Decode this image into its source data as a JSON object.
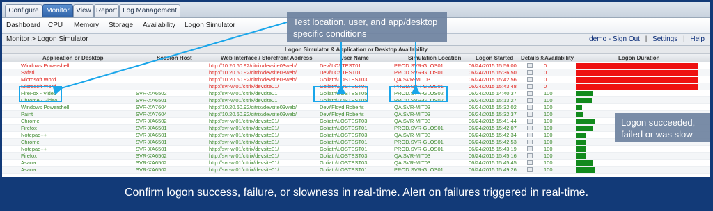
{
  "tabs": [
    {
      "label": "Configure",
      "active": false
    },
    {
      "label": "Monitor",
      "active": true
    },
    {
      "label": "View",
      "active": false
    },
    {
      "label": "Report",
      "active": false
    },
    {
      "label": "Log Management",
      "active": false
    }
  ],
  "subnav": [
    "Dashboard",
    "CPU",
    "Memory",
    "Storage",
    "Availability",
    "Logon Simulator"
  ],
  "breadcrumb": "Monitor > Logon Simulator",
  "user_links": {
    "signout": "demo - Sign Out",
    "settings": "Settings",
    "help": "Help",
    "separator": "|"
  },
  "panel_title": "Logon Simulator & Application or Desktop Availability",
  "columns": {
    "app": "Application or Desktop",
    "session": "Session Host",
    "web": "Web Interface / Storefront Address",
    "user": "User Name",
    "sim": "Simulation Location",
    "started": "Logon Started",
    "details": "Details",
    "avail": "%Availability",
    "duration": "Logon Duration"
  },
  "rows": [
    {
      "app": "Windows Powershell",
      "session": "",
      "web": "http://10.20.60.92/citrix/devsite03web/",
      "user": "Devi\\LOSTEST01",
      "sim": "PROD.SVR-GLOS01",
      "started": "06/24/2015 15:56:00",
      "availability": "0",
      "status": "fail",
      "duration_fraction": 1.0
    },
    {
      "app": "Safari",
      "session": "",
      "web": "http://10.20.60.92/citrix/devsite03web/",
      "user": "Devi\\LOSTEST01",
      "sim": "PROD.SVR-GLOS01",
      "started": "06/24/2015 15:36:50",
      "availability": "0",
      "status": "fail",
      "duration_fraction": 1.0
    },
    {
      "app": "Microsoft Word",
      "session": "",
      "web": "http://10.20.60.92/citrix/devsite03web/",
      "user": "Goliath\\LOSTEST03",
      "sim": "QA.SVR-MIT03",
      "started": "06/24/2015 15:42:56",
      "availability": "0",
      "status": "fail",
      "duration_fraction": 1.0
    },
    {
      "app": "Microsoft Word",
      "session": "",
      "web": "http://svr-wi01/citrix/devsite01/",
      "user": "Goliath\\LOSTEST01",
      "sim": "PROD.SVR-GLOS01",
      "started": "06/24/2015 15:43:48",
      "availability": "0",
      "status": "fail",
      "duration_fraction": 1.0
    },
    {
      "app": "FireFox - Video",
      "session": "SVR-XA6502",
      "web": "http://svr-wi01/citrix/devsite01",
      "user": "Goliath\\LOSTEST05",
      "sim": "PROD.SVR-GLOS02",
      "started": "06/24/2015 14:40:37",
      "availability": "100",
      "status": "ok",
      "duration_fraction": 0.14
    },
    {
      "app": "Chrome - Video",
      "session": "SVR-XA6501",
      "web": "http://svr-wi01/citrix/devsite01",
      "user": "Goliath\\LOSTEST05",
      "sim": "PROD.SVR-GLOS02",
      "started": "06/24/2015 15:13:27",
      "availability": "100",
      "status": "ok",
      "duration_fraction": 0.13
    },
    {
      "app": "Windows Powershell",
      "session": "SVR-XA7604",
      "web": "http://10.20.60.92/citrix/devsite03web/",
      "user": "Devi\\Floyd Roberts",
      "sim": "QA.SVR-MIT03",
      "started": "06/24/2015 15:32:02",
      "availability": "100",
      "status": "ok",
      "duration_fraction": 0.05
    },
    {
      "app": "Paint",
      "session": "SVR-XA7604",
      "web": "http://10.20.60.92/citrix/devsite03web/",
      "user": "Devi\\Floyd Roberts",
      "sim": "QA.SVR-MIT03",
      "started": "06/24/2015 15:32:37",
      "availability": "100",
      "status": "ok",
      "duration_fraction": 0.06
    },
    {
      "app": "Chrome",
      "session": "SVR-XA6502",
      "web": "http://svr-wi01/citrix/devsite01/",
      "user": "Goliath\\LOSTEST03",
      "sim": "QA.SVR-MIT03",
      "started": "06/24/2015 15:41:44",
      "availability": "100",
      "status": "ok",
      "duration_fraction": 0.16
    },
    {
      "app": "Firefox",
      "session": "SVR-XA6501",
      "web": "http://svr-wi01/citrix/devsite01/",
      "user": "Goliath\\LOSTEST01",
      "sim": "PROD.SVR-GLOS01",
      "started": "06/24/2015 15:42:07",
      "availability": "100",
      "status": "ok",
      "duration_fraction": 0.14
    },
    {
      "app": "Notepad++",
      "session": "SVR-XA6501",
      "web": "http://svr-wi01/citrix/devsite01/",
      "user": "Goliath\\LOSTEST03",
      "sim": "QA.SVR-MIT03",
      "started": "06/24/2015 15:42:34",
      "availability": "100",
      "status": "ok",
      "duration_fraction": 0.08
    },
    {
      "app": "Chrome",
      "session": "SVR-XA6501",
      "web": "http://svr-wi01/citrix/devsite01/",
      "user": "Goliath\\LOSTEST01",
      "sim": "PROD.SVR-GLOS01",
      "started": "06/24/2015 15:42:53",
      "availability": "100",
      "status": "ok",
      "duration_fraction": 0.08
    },
    {
      "app": "Notepad++",
      "session": "SVR-XA6501",
      "web": "http://svr-wi01/citrix/devsite01/",
      "user": "Goliath\\LOSTEST01",
      "sim": "PROD.SVR-GLOS01",
      "started": "06/24/2015 15:43:19",
      "availability": "100",
      "status": "ok",
      "duration_fraction": 0.08
    },
    {
      "app": "Firefox",
      "session": "SVR-XA6502",
      "web": "http://svr-wi01/citrix/devsite01/",
      "user": "Goliath\\LOSTEST03",
      "sim": "QA.SVR-MIT03",
      "started": "06/24/2015 15:45:16",
      "availability": "100",
      "status": "ok",
      "duration_fraction": 0.08
    },
    {
      "app": "Asana",
      "session": "SVR-XA6502",
      "web": "http://svr-wi01/citrix/devsite01/",
      "user": "Goliath\\LOSTEST03",
      "sim": "QA.SVR-MIT03",
      "started": "06/24/2015 15:45:45",
      "availability": "100",
      "status": "ok",
      "duration_fraction": 0.14
    },
    {
      "app": "Asana",
      "session": "SVR-XA6502",
      "web": "http://svr-wi01/citrix/devsite01/",
      "user": "Goliath\\LOSTEST01",
      "sim": "PROD.SVR-GLOS01",
      "started": "06/24/2015 15:49:26",
      "availability": "100",
      "status": "ok",
      "duration_fraction": 0.16
    }
  ],
  "colors": {
    "fail": "#e0201a",
    "ok": "#3d8a2e",
    "fail_bar": "#ee1111",
    "ok_bar": "#128a1d",
    "highlight": "#1aa6ea"
  },
  "callouts": {
    "conditions": "Test location, user, and app/desktop specific conditions",
    "result": "Logon succeeded, failed or was slow"
  },
  "footer": "Confirm logon success, failure, or slowness in real-time. Alert on failures triggered in real-time."
}
